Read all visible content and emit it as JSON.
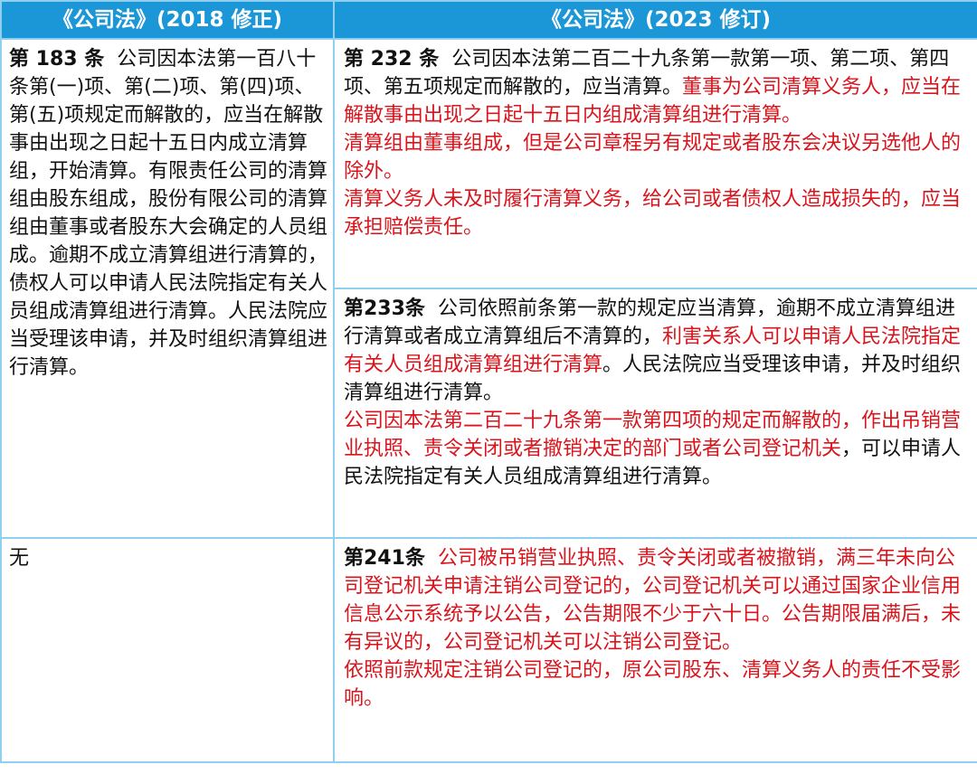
{
  "header": {
    "left_title": "《公司法》(2018 修正)",
    "right_title": "《公司法》(2023 修订)"
  },
  "left_183": {
    "article": "第 183 条",
    "text": "公司因本法第一百八十条第(一)项、第(二)项、第(四)项、第(五)项规定而解散的，应当在解散事由出现之日起十五日内成立清算组，开始清算。有限责任公司的清算组由股东组成，股份有限公司的清算组由董事或者股东大会确定的人员组成。逾期不成立清算组进行清算的，债权人可以申请人民法院指定有关人员组成清算组进行清算。人民法院应当受理该申请，并及时组织清算组进行清算。"
  },
  "right_232": {
    "article": "第 232 条",
    "text_a": "公司因本法第二百二十九条第一款第一项、第二项、第四项、第五项规定而解散的，应当清算。",
    "text_b_red": "董事为公司清算义务人，应当在解散事由出现之日起十五日内组成清算组进行清算。",
    "para2_red": "清算组由董事组成，但是公司章程另有规定或者股东会决议另选他人的除外。",
    "para3_red": "清算义务人未及时履行清算义务，给公司或者债权人造成损失的，应当承担赔偿责任。"
  },
  "right_233": {
    "article": "第233条",
    "text_a": "公司依照前条第一款的规定应当清算，逾期不成立清算组进行清算或者成立清算组后不清算的，",
    "text_b_red": "利害关系人可以申请人民法院指定有关人员组成清算组进行清算",
    "text_c": "。人民法院应当受理该申请，并及时组织清算组进行清算。",
    "para2_red": "公司因本法第二百二十九条第一款第四项的规定而解散的，作出吊销营业执照、责令关闭或者撤销决定的部门或者公司登记机关",
    "para2_black": "，可以申请人民法院指定有关人员组成清算组进行清算。"
  },
  "left_none": {
    "text": "无"
  },
  "right_241": {
    "article": "第241条",
    "text_red": "公司被吊销营业执照、责令关闭或者被撤销，满三年未向公司登记机关申请注销公司登记的，公司登记机关可以通过国家企业信用信息公示系统予以公告，公告期限不少于六十日。公告期限届满后，未有异议的，公司登记机关可以注销公司登记。",
    "para2_red": "依照前款规定注销公司登记的，原公司股东、清算义务人的责任不受影响。"
  },
  "colors": {
    "header_bg": "#1b97d8",
    "border": "#8fd0f0",
    "highlight_red": "#d9141c"
  }
}
